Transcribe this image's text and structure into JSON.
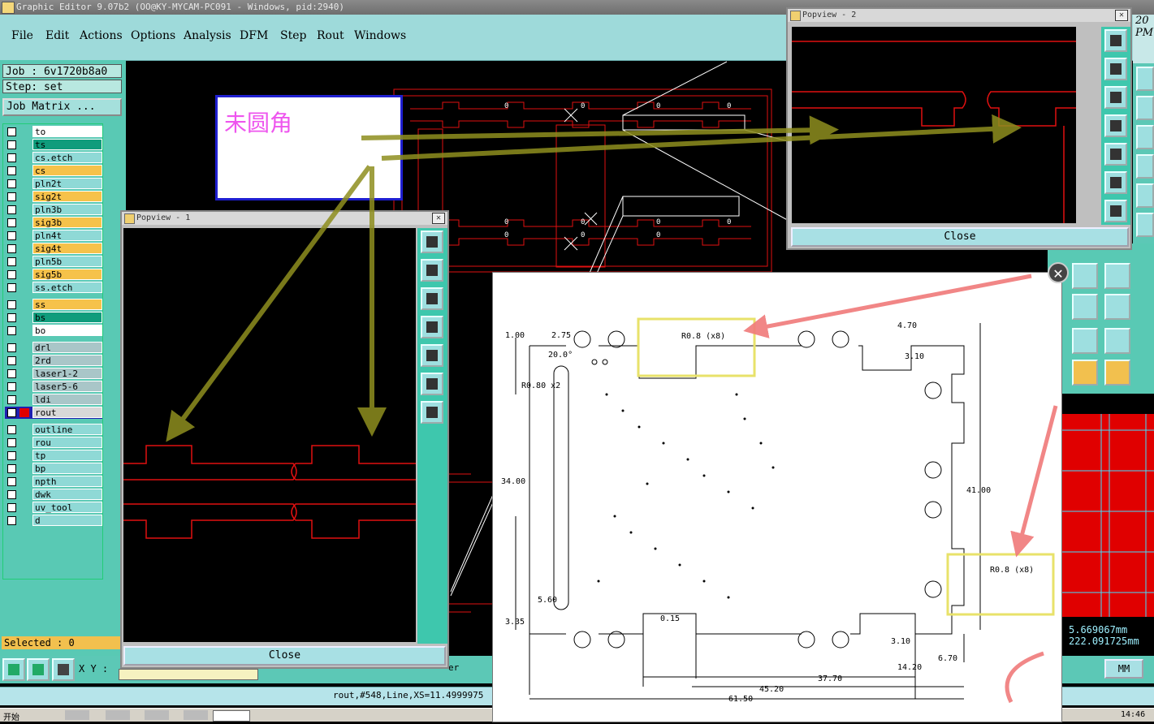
{
  "window": {
    "title": "Graphic Editor 9.07b2  (OO@KY-MYCAM-PC091 - Windows, pid:2940)"
  },
  "menu": [
    "File",
    "Edit",
    "Actions",
    "Options",
    "Analysis",
    "DFM",
    "Step",
    "Rout",
    "Windows"
  ],
  "job": {
    "job_label": "Job : 6v1720b8a0",
    "step_label": "Step: set",
    "matrix_button": "Job Matrix ..."
  },
  "layers": [
    {
      "name": "to",
      "color": "#ffffff"
    },
    {
      "name": "ts",
      "color": "#0f9c7c"
    },
    {
      "name": "cs.etch",
      "color": "#8fd9d6"
    },
    {
      "name": "cs",
      "color": "#f6c24a"
    },
    {
      "name": "pln2t",
      "color": "#8fd9d6"
    },
    {
      "name": "sig2t",
      "color": "#f6c24a"
    },
    {
      "name": "pln3b",
      "color": "#8fd9d6"
    },
    {
      "name": "sig3b",
      "color": "#f6c24a"
    },
    {
      "name": "pln4t",
      "color": "#8fd9d6"
    },
    {
      "name": "sig4t",
      "color": "#f6c24a"
    },
    {
      "name": "pln5b",
      "color": "#8fd9d6"
    },
    {
      "name": "sig5b",
      "color": "#f6c24a"
    },
    {
      "name": "ss.etch",
      "color": "#8fd9d6"
    },
    {
      "name": "ss",
      "color": "#f6c24a"
    },
    {
      "name": "bs",
      "color": "#0f9c7c"
    },
    {
      "name": "bo",
      "color": "#ffffff"
    },
    {
      "name": "drl",
      "color": "#a9c6c8"
    },
    {
      "name": "2rd",
      "color": "#a9c6c8"
    },
    {
      "name": "laser1-2",
      "color": "#a9c6c8"
    },
    {
      "name": "laser5-6",
      "color": "#a9c6c8"
    },
    {
      "name": "ldi",
      "color": "#a9c6c8"
    },
    {
      "name": "rout",
      "color": "#d8d8d8"
    },
    {
      "name": "outline",
      "color": "#8fd9d6"
    },
    {
      "name": "rou",
      "color": "#8fd9d6"
    },
    {
      "name": "tp",
      "color": "#8fd9d6"
    },
    {
      "name": "bp",
      "color": "#8fd9d6"
    },
    {
      "name": "npth",
      "color": "#8fd9d6"
    },
    {
      "name": "dwk",
      "color": "#8fd9d6"
    },
    {
      "name": "uv_tool",
      "color": "#8fd9d6"
    },
    {
      "name": "d",
      "color": "#8fd9d6"
    }
  ],
  "selected": "Selected : 0",
  "xy_label": "X Y :",
  "status": "rout,#548,Line,XS=11.4999975",
  "status_er": "er",
  "taskbar": {
    "start": "开始",
    "time": "14:46"
  },
  "popview1": {
    "title": "Popview - 1",
    "close": "Close"
  },
  "popview2": {
    "title": "Popview - 2",
    "close": "Close"
  },
  "annotation": "未圆角",
  "side_label": {
    "line1": "20",
    "line2": "PM"
  },
  "coords": {
    "x": "5.669067mm",
    "y": "222.091725mm"
  },
  "units_button": "MM",
  "drawing": {
    "labels": [
      "1.00",
      "2.75",
      "20.0°",
      "R0.80 x2",
      "R0.8 (x8)",
      "4.70",
      "3.10",
      "41.00",
      "34.00",
      "5.60",
      "3.35",
      "0.15",
      "3.10",
      "6.70",
      "14.20",
      "37.70",
      "45.20",
      "61.50",
      "R0.8 (x8)"
    ]
  }
}
